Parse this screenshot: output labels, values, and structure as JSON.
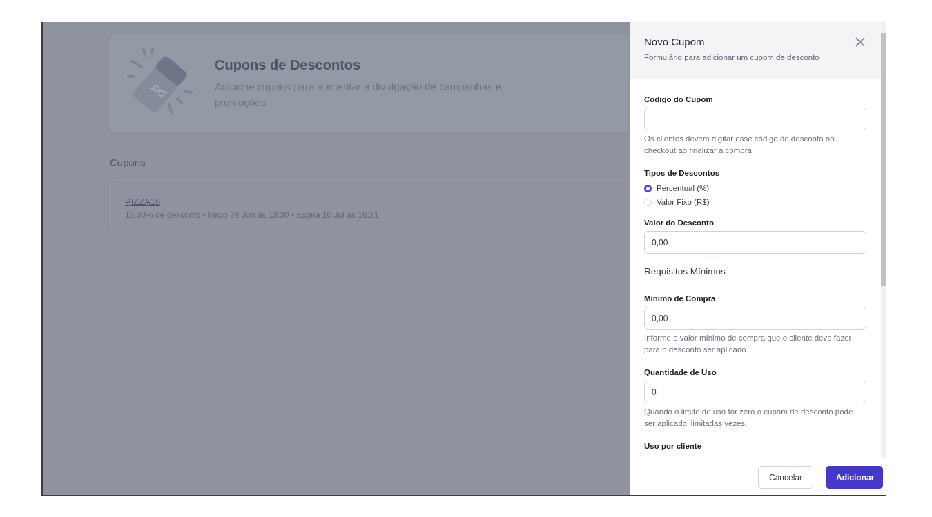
{
  "page": {
    "title": "Cupons de Descontos",
    "description": "Adicione cupons para aumentar a divulgação de campanhas e promoções"
  },
  "coupons_heading": "Cupons",
  "coupons": [
    {
      "code": "PIZZA15",
      "details": "15,00% de desconto • Início 24 Jun ás 13:30 • Expira 10 Jul ás 16:31"
    }
  ],
  "drawer": {
    "title": "Novo Cupom",
    "subtitle": "Formulário para adicionar um cupom de desconto",
    "fields": [
      {
        "kind": "text",
        "label": "Código do Cupom",
        "help": "Os clientes devem digitar esse código de desconto no checkout ao finalizar a compra."
      },
      {
        "kind": "radio",
        "label": "Tipos de Descontos",
        "options": [
          {
            "label": "Percentual (%)",
            "selected": true
          },
          {
            "label": "Valor Fixo (R$)",
            "selected": false
          }
        ]
      },
      {
        "kind": "text",
        "label": "Valor do Desconto",
        "value": "0,00"
      },
      {
        "kind": "section",
        "label": "Requisitos Mínimos"
      },
      {
        "kind": "text",
        "label": "Mínimo de Compra",
        "value": "0,00",
        "help": "Informe o valor mínimo de compra que o cliente deve fazer para o desconto ser aplicado."
      },
      {
        "kind": "text",
        "label": "Quantidade de Uso",
        "value": "0",
        "help": "Quando o limite de uso for zero o cupom de desconto pode ser aplicado ilimitadas vezes."
      },
      {
        "kind": "label",
        "label": "Uso por cliente"
      }
    ],
    "buttons": [
      {
        "label": "Cancelar",
        "kind": "secondary"
      },
      {
        "label": "Adicionar",
        "kind": "primary"
      }
    ]
  }
}
